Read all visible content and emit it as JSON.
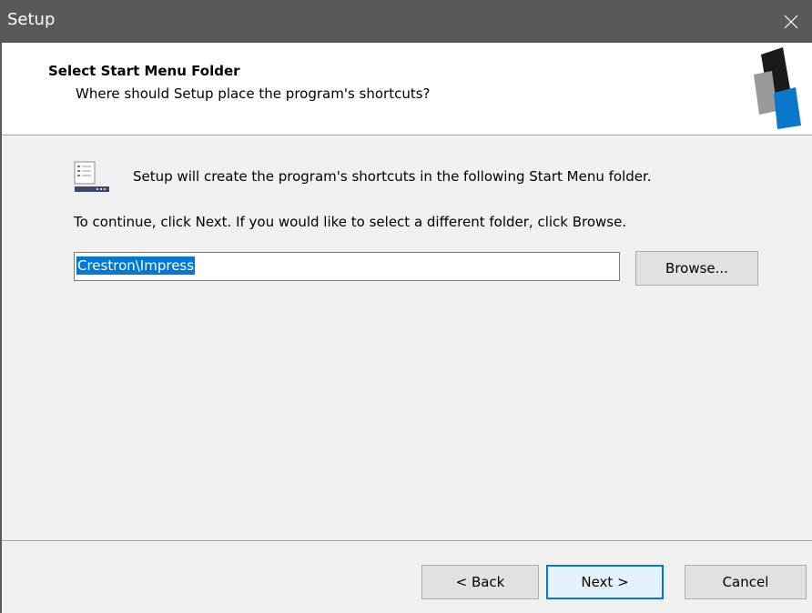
{
  "window": {
    "title": "Setup",
    "close_icon": "close-icon"
  },
  "header": {
    "title": "Select Start Menu Folder",
    "subtitle": "Where should Setup place the program's shortcuts?",
    "logo_icon": "setup-logo-icon"
  },
  "content": {
    "info_icon": "start-menu-folder-icon",
    "info_text": "Setup will create the program's shortcuts in the following Start Menu folder.",
    "instruction_text": "To continue, click Next. If you would like to select a different folder, click Browse.",
    "folder_input": {
      "value": "Crestron\\Impress",
      "selected": true
    },
    "browse_button": {
      "label": "Browse...",
      "mnemonic": "r"
    }
  },
  "footer": {
    "back_button": {
      "label": "< Back",
      "mnemonic": "B"
    },
    "next_button": {
      "label": "Next >",
      "mnemonic": "N"
    },
    "cancel_button": {
      "label": "Cancel"
    }
  },
  "colors": {
    "titlebar": "#595959",
    "selection": "#0078d7",
    "logo_dark": "#1a1a1a",
    "logo_gray": "#9a9a9a",
    "logo_blue": "#0a78c8"
  }
}
